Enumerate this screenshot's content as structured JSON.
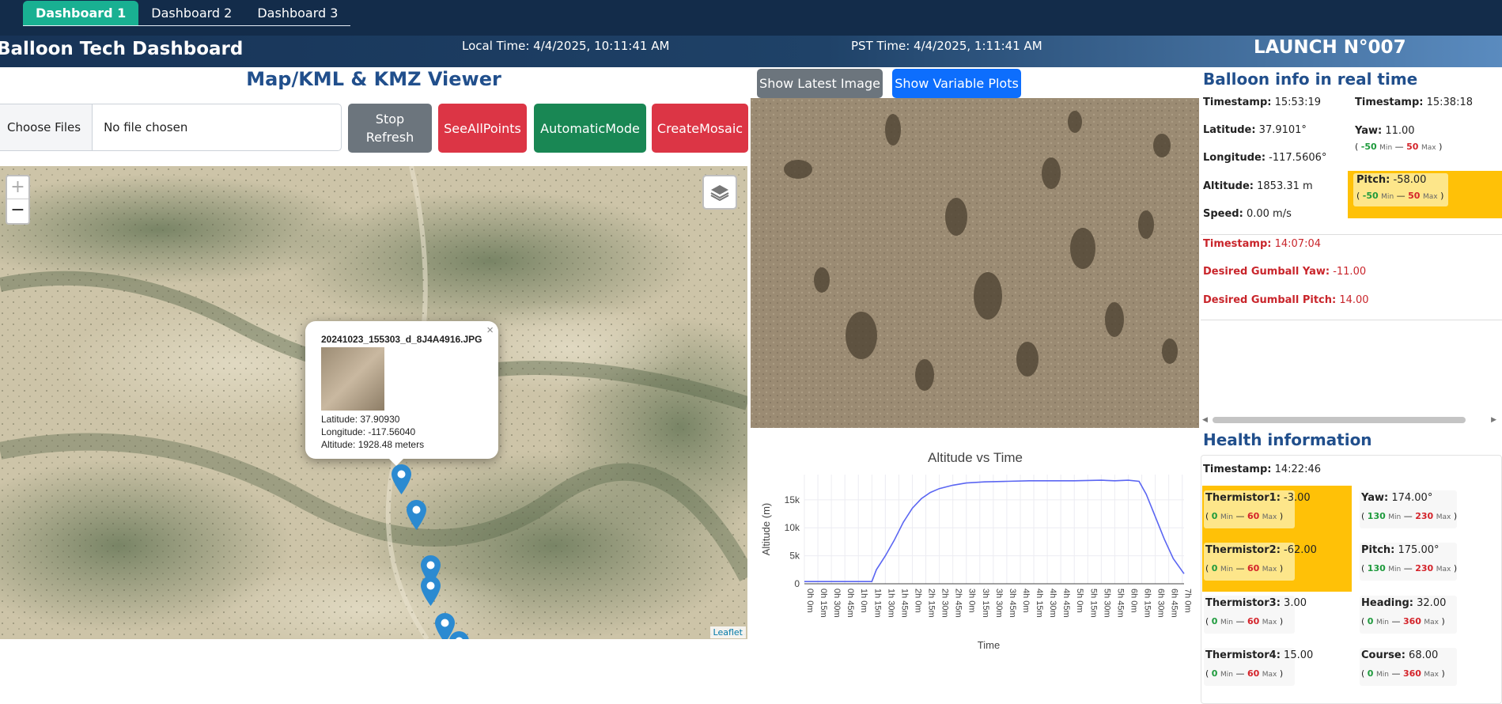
{
  "nav": {
    "tabs": [
      "Dashboard 1",
      "Dashboard 2",
      "Dashboard 3"
    ]
  },
  "header": {
    "title": "Balloon Tech Dashboard",
    "local_time": "Local Time: 4/4/2025, 10:11:41 AM",
    "pst_time": "PST Time: 4/4/2025, 1:11:41 AM",
    "launch": "LAUNCH N°007"
  },
  "viewer": {
    "title": "Map/KML & KMZ Viewer",
    "choose_files": "Choose Files",
    "no_file": "No file chosen",
    "stop_refresh": "Stop Refresh",
    "see_all": "SeeAllPoints",
    "auto_mode": "AutomaticMode",
    "create_mosaic": "CreateMosaic",
    "zoom_in": "+",
    "zoom_out": "−",
    "attribution": "Leaflet",
    "popup": {
      "filename": "20241023_155303_d_8J4A4916.JPG",
      "lat": "Latitude: 37.90930",
      "lon": "Longitude: -117.56040",
      "alt": "Altitude: 1928.48 meters",
      "close": "×"
    }
  },
  "image_panel": {
    "show_latest": "Show Latest Image",
    "show_plots": "Show Variable Plots"
  },
  "colors": {
    "nav_bg": "#132c4a",
    "tab_active": "#19b092",
    "btn_grey": "#6c757d",
    "btn_red": "#dc3545",
    "btn_green": "#198754",
    "btn_blue": "#0d6efd",
    "highlight": "#ffc107",
    "title_blue": "#214f8c",
    "line": "#5b66f2"
  },
  "chart_data": {
    "type": "line",
    "title": "Altitude vs Time",
    "xlabel": "Time",
    "ylabel": "Altitude (m)",
    "yticks": [
      "0",
      "5k",
      "10k",
      "15k"
    ],
    "x_ticks": [
      "0h 0m",
      "0h 15m",
      "0h 30m",
      "0h 45m",
      "1h 0m",
      "1h 15m",
      "1h 30m",
      "1h 45m",
      "2h 0m",
      "2h 15m",
      "2h 30m",
      "2h 45m",
      "3h 0m",
      "3h 15m",
      "3h 30m",
      "3h 45m",
      "4h 0m",
      "4h 15m",
      "4h 30m",
      "4h 45m",
      "5h 0m",
      "5h 15m",
      "5h 30m",
      "5h 45m",
      "6h 0m",
      "6h 15m",
      "6h 30m",
      "6h 45m",
      "7h 0m"
    ],
    "x_minutes": [
      0,
      15,
      30,
      45,
      60,
      75,
      80,
      90,
      100,
      110,
      120,
      130,
      140,
      150,
      165,
      180,
      200,
      225,
      250,
      270,
      300,
      330,
      345,
      360,
      372,
      380,
      390,
      400,
      410,
      422
    ],
    "y": [
      400,
      400,
      400,
      400,
      400,
      400,
      2500,
      5000,
      7800,
      11000,
      13500,
      15200,
      16300,
      17000,
      17600,
      18000,
      18200,
      18300,
      18400,
      18400,
      18400,
      18500,
      18400,
      18500,
      18300,
      16000,
      12000,
      8000,
      4500,
      1800
    ],
    "ylim": [
      0,
      19500
    ],
    "xlim": [
      0,
      422
    ],
    "grid": true
  },
  "balloon": {
    "title": "Balloon info in real time",
    "ts_label": "Timestamp:",
    "ts": "15:53:19",
    "lat_label": "Latitude:",
    "lat": "37.9101°",
    "lon_label": "Longitude:",
    "lon": "-117.5606°",
    "alt_label": "Altitude:",
    "alt": "1853.31 m",
    "speed_label": "Speed:",
    "speed": "0.00 m/s",
    "ts2_label": "Timestamp:",
    "ts2": "15:38:18",
    "yaw_label": "Yaw:",
    "yaw": "11.00",
    "yaw_min": "-50",
    "yaw_max": "50",
    "pitch_label": "Pitch:",
    "pitch": "-58.00",
    "pitch_min": "-50",
    "pitch_max": "50",
    "min_word": "Min",
    "max_word": "Max",
    "open": "(",
    "close": ")",
    "dash": "—",
    "gts_label": "Timestamp:",
    "gts": "14:07:04",
    "gyaw_label": "Desired Gumball Yaw:",
    "gyaw": "-11.00",
    "gpitch_label": "Desired Gumball Pitch:",
    "gpitch": "14.00"
  },
  "health": {
    "title": "Health information",
    "ts_label": "Timestamp:",
    "ts": "14:22:46",
    "items": [
      {
        "label": "Thermistor1:",
        "value": "-3.00",
        "min": "0",
        "max": "60"
      },
      {
        "label": "Yaw:",
        "value": "174.00°",
        "min": "130",
        "max": "230"
      },
      {
        "label": "Thermistor2:",
        "value": "-62.00",
        "min": "0",
        "max": "60"
      },
      {
        "label": "Pitch:",
        "value": "175.00°",
        "min": "130",
        "max": "230"
      },
      {
        "label": "Thermistor3:",
        "value": "3.00",
        "min": "0",
        "max": "60"
      },
      {
        "label": "Heading:",
        "value": "32.00",
        "min": "0",
        "max": "360"
      },
      {
        "label": "Thermistor4:",
        "value": "15.00",
        "min": "0",
        "max": "60"
      },
      {
        "label": "Course:",
        "value": "68.00",
        "min": "0",
        "max": "360"
      }
    ]
  }
}
